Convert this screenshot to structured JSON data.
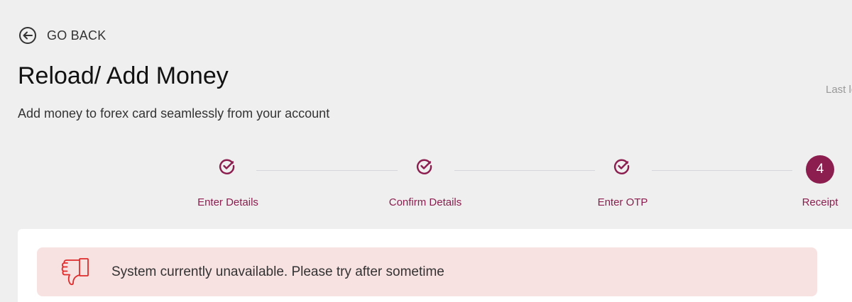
{
  "nav": {
    "back_label": "GO BACK"
  },
  "header": {
    "title": "Reload/ Add Money",
    "subtitle": "Add money to forex card seamlessly from your account",
    "last_login_partial": "Last lo"
  },
  "stepper": {
    "steps": [
      {
        "label": "Enter Details",
        "status": "done"
      },
      {
        "label": "Confirm Details",
        "status": "done"
      },
      {
        "label": "Enter OTP",
        "status": "done"
      },
      {
        "label": "Receipt",
        "status": "current",
        "number": "4"
      }
    ]
  },
  "alert": {
    "message": "System currently unavailable. Please try after sometime",
    "icon": "thumbs-down-icon"
  },
  "colors": {
    "accent": "#8b1e4e",
    "alert_bg": "#f8e1e1",
    "alert_icon": "#e02b2b",
    "page_bg": "#efefef"
  }
}
